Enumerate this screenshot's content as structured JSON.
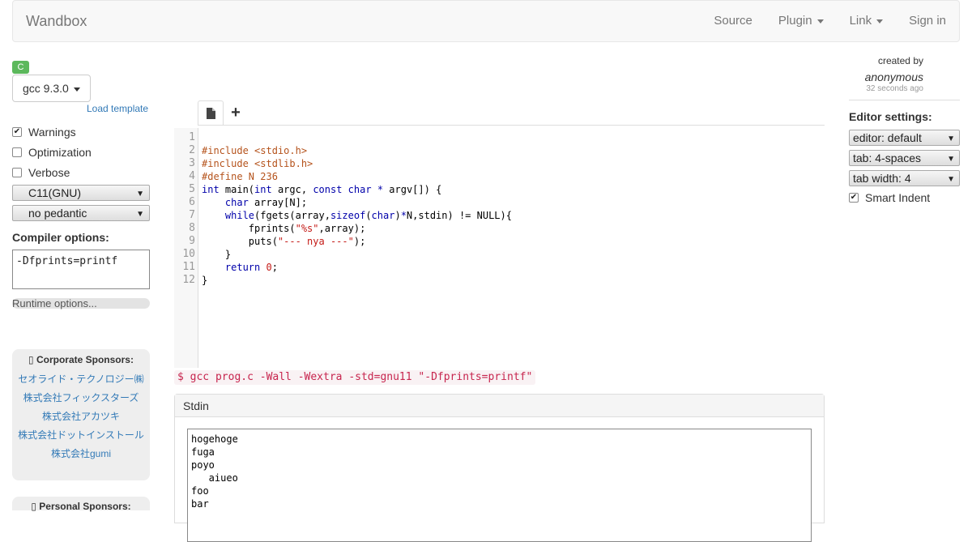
{
  "navbar": {
    "brand": "Wandbox",
    "items": [
      {
        "label": "Source",
        "dropdown": false
      },
      {
        "label": "Plugin",
        "dropdown": true
      },
      {
        "label": "Link",
        "dropdown": true
      },
      {
        "label": "Sign in",
        "dropdown": false
      }
    ]
  },
  "language_badge": "C",
  "compiler": {
    "selected": "gcc 9.3.0"
  },
  "load_template": "Load template",
  "options": {
    "warnings": {
      "label": "Warnings",
      "checked": true
    },
    "optimization": {
      "label": "Optimization",
      "checked": false
    },
    "verbose": {
      "label": "Verbose",
      "checked": false
    },
    "std_select": "C11(GNU)",
    "pedantic_select": "no pedantic"
  },
  "compiler_options": {
    "label": "Compiler options:",
    "value": "-Dfprints=printf"
  },
  "runtime_options": {
    "label": "Runtime options..."
  },
  "sponsors": {
    "corporate_title": "Corporate Sponsors:",
    "corporate": [
      "セオライド・テクノロジー㈱",
      "株式会社フィックスターズ",
      "株式会社アカツキ",
      "株式会社ドットインストール",
      "株式会社gumi"
    ],
    "personal_title": "Personal Sponsors:"
  },
  "editor": {
    "tab_add_label": "+",
    "line_numbers": [
      "1",
      "2",
      "3",
      "4",
      "5",
      "6",
      "7",
      "8",
      "9",
      "10",
      "11",
      "12"
    ],
    "code_lines": [
      "",
      "#include <stdio.h>",
      "#include <stdlib.h>",
      "#define N 236",
      "int main(int argc, const char * argv[]) {",
      "    char array[N];",
      "    while(fgets(array,sizeof(char)*N,stdin) != NULL){",
      "        fprints(\"%s\",array);",
      "        puts(\"--- nya ---\");",
      "    }",
      "    return 0;",
      "}"
    ]
  },
  "command_line": "$ gcc prog.c -Wall -Wextra -std=gnu11 \"-Dfprints=printf\"",
  "stdin": {
    "title": "Stdin",
    "value": "hogehoge\nfuga\npoyo\n   aiueo\nfoo\nbar"
  },
  "author_info": {
    "created_by": "created by",
    "author": "anonymous",
    "time_ago": "32 seconds ago"
  },
  "editor_settings": {
    "label": "Editor settings:",
    "editor_mode": "editor: default",
    "tab_mode": "tab: 4-spaces",
    "tab_width": "tab width: 4",
    "smart_indent": {
      "label": "Smart Indent",
      "checked": true
    }
  },
  "colors": {
    "accent": "#337ab7",
    "badge": "#5cb85c",
    "command": "#c7254e"
  }
}
